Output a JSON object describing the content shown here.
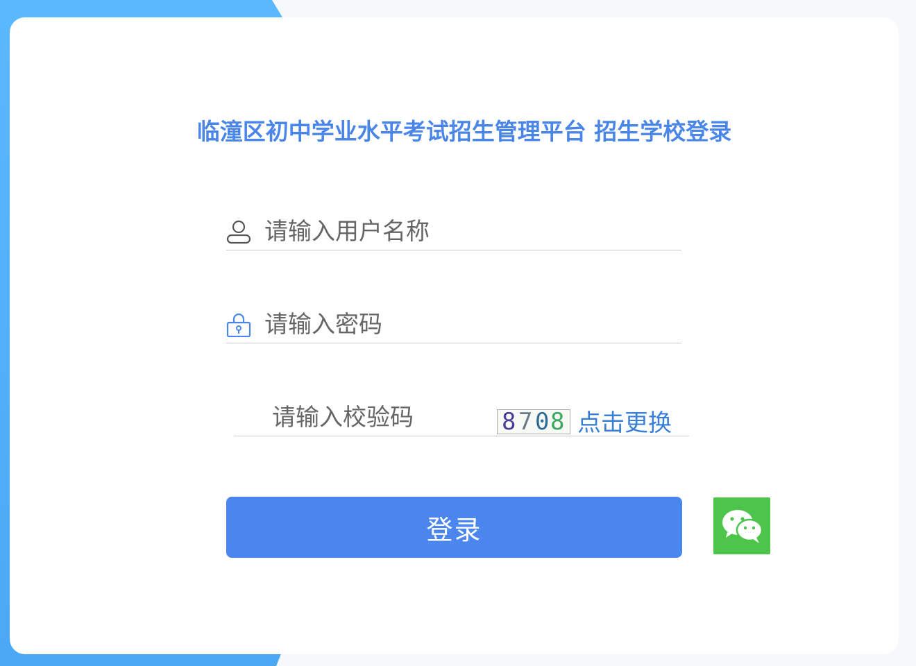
{
  "page": {
    "title": "临潼区初中学业水平考试招生管理平台 招生学校登录"
  },
  "form": {
    "username_placeholder": "请输入用户名称",
    "password_placeholder": "请输入密码",
    "captcha_placeholder": "请输入校验码",
    "captcha_refresh_label": "点击更换",
    "login_label": "登录"
  },
  "captcha": {
    "digits": [
      "8",
      "7",
      "0",
      "8"
    ],
    "digit_colors": [
      "#4a3f9a",
      "#6a7a8a",
      "#2e6a9a",
      "#3aa860"
    ]
  },
  "icons": {
    "username": "user-icon",
    "password": "lock-icon",
    "wechat": "wechat-icon"
  },
  "colors": {
    "accent": "#4a86ee",
    "title": "#4a86e8",
    "link": "#3a7fd6",
    "wechat": "#4cc54a",
    "side_stripe": "#5bb8ff"
  }
}
